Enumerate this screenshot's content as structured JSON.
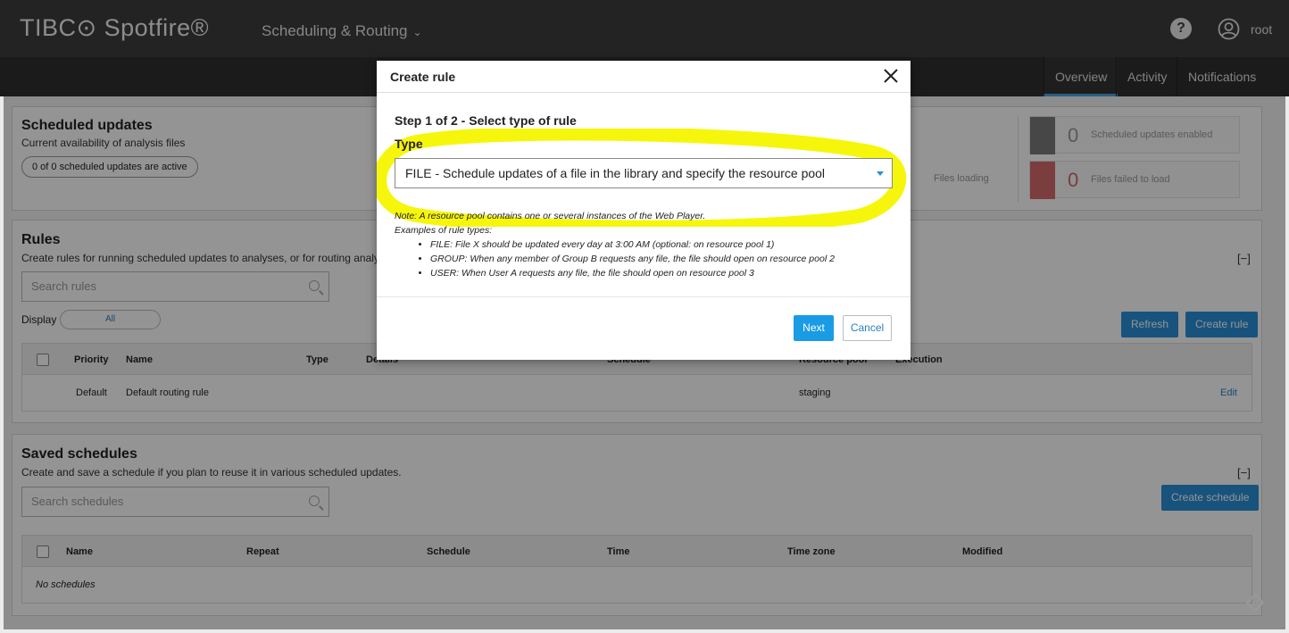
{
  "header": {
    "logo": "TIBC⊙ Spotfire®",
    "app_title": "Scheduling & Routing",
    "help": "?",
    "user": "root"
  },
  "tabs": [
    {
      "label": "Overview",
      "active": true
    },
    {
      "label": "Activity"
    },
    {
      "label": "Notifications"
    }
  ],
  "scheduled": {
    "title": "Scheduled updates",
    "subtitle": "Current availability of analysis files",
    "active_pill": "0 of 0 scheduled updates are active",
    "files_loading": "Files loading",
    "stats": [
      {
        "value": "0",
        "label": "Scheduled updates enabled",
        "color": "#7a7a7a"
      },
      {
        "value": "0",
        "label": "Files failed to load",
        "color": "#d46a6a"
      }
    ]
  },
  "rules": {
    "title": "Rules",
    "subtitle": "Create rules for running scheduled updates to analyses, or for routing analy",
    "search_placeholder": "Search rules",
    "display_label": "Display",
    "display_value": "All",
    "refresh": "Refresh",
    "create": "Create rule",
    "collapse": "[−]",
    "columns": [
      "Priority",
      "Name",
      "Type",
      "Details",
      "Schedule",
      "Resource pool",
      "Execution"
    ],
    "row": {
      "priority": "Default",
      "name": "Default routing rule",
      "pool": "staging",
      "edit": "Edit"
    }
  },
  "saved": {
    "title": "Saved schedules",
    "subtitle": "Create and save a schedule if you plan to reuse it in various scheduled updates.",
    "search_placeholder": "Search schedules",
    "create": "Create schedule",
    "collapse": "[−]",
    "columns": [
      "Name",
      "Repeat",
      "Schedule",
      "Time",
      "Time zone",
      "Modified"
    ],
    "empty": "No schedules"
  },
  "modal": {
    "title": "Create rule",
    "step": "Step 1 of 2 - Select type of rule",
    "type_label": "Type",
    "type_value": "FILE - Schedule updates of a file in the library and specify the resource pool",
    "note": "Note: A resource pool contains one or several instances of the Web Player.",
    "examples_label": "Examples of rule types:",
    "examples": [
      "FILE: File X should be updated every day at 3:00 AM (optional: on resource pool 1)",
      "GROUP: When any member of Group B requests any file, the file should open on resource pool 2",
      "USER: When User A requests any file, the file should open on resource pool 3"
    ],
    "next": "Next",
    "cancel": "Cancel",
    "highlight_color": "#f5f500"
  }
}
